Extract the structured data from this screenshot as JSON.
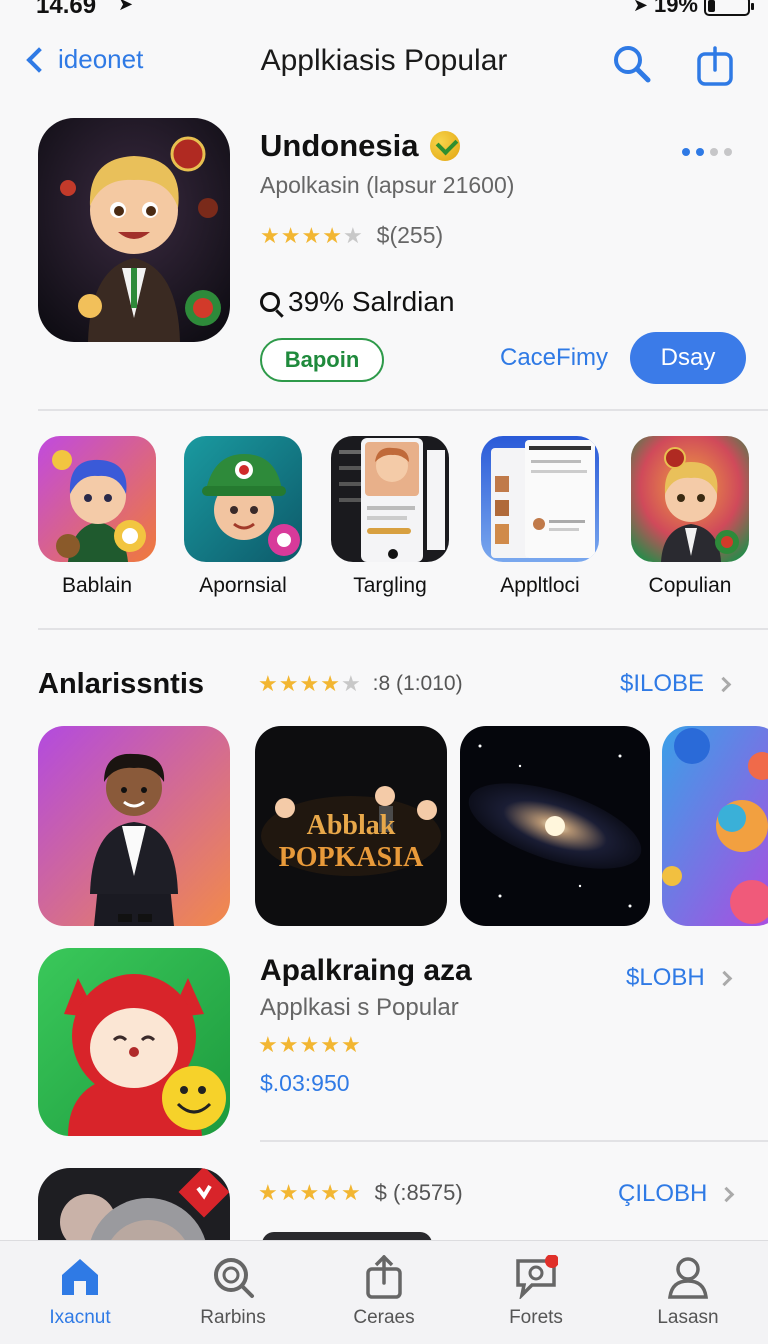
{
  "status_bar": {
    "time": "14.69",
    "battery": "19%",
    "battery_level": 0.19
  },
  "nav": {
    "back_label": "ideonet",
    "title": "Applkiasis Popular"
  },
  "hero": {
    "name": "Undonesia",
    "subtitle": "Apolkasin (lapsur 21600)",
    "rating": 3.5,
    "rating_text": "$(255)",
    "tag": "39% Salrdian",
    "outline_button": "Bapoin",
    "link": "CaceFimy",
    "primary_button": "Dsay"
  },
  "categories": [
    {
      "label": "Bablain"
    },
    {
      "label": "Apornsial"
    },
    {
      "label": "Targling"
    },
    {
      "label": "Appltloci"
    },
    {
      "label": "Copulian"
    }
  ],
  "section": {
    "title": "Anlarissntis",
    "rating": 4,
    "rating_text": ":8 (1:010)",
    "link": "$ILOBE"
  },
  "featured_cards": [
    {
      "kind": "character"
    },
    {
      "kind": "poster",
      "line1": "Abblak",
      "line2": "POPKASIA"
    },
    {
      "kind": "galaxy"
    },
    {
      "kind": "bubbles"
    }
  ],
  "list": [
    {
      "name": "Apalkraing aza",
      "subtitle": "Applkasi s Popular",
      "rating": 4.5,
      "price": "$.03:950",
      "link": "$LOBH"
    },
    {
      "rating": 4.5,
      "rating_text": "$ (:8575)",
      "link": "ÇILOBH"
    }
  ],
  "tabs": [
    {
      "label": "Ixacnut",
      "icon": "home-icon",
      "active": true
    },
    {
      "label": "Rarbins",
      "icon": "search-target-icon",
      "active": false
    },
    {
      "label": "Ceraes",
      "icon": "share-icon",
      "active": false
    },
    {
      "label": "Forets",
      "icon": "chat-search-icon",
      "active": false
    },
    {
      "label": "Lasasn",
      "icon": "person-icon",
      "active": false
    }
  ],
  "colors": {
    "accent": "#2f7ae5",
    "star": "#f2b632",
    "green": "#2e9a4a"
  }
}
